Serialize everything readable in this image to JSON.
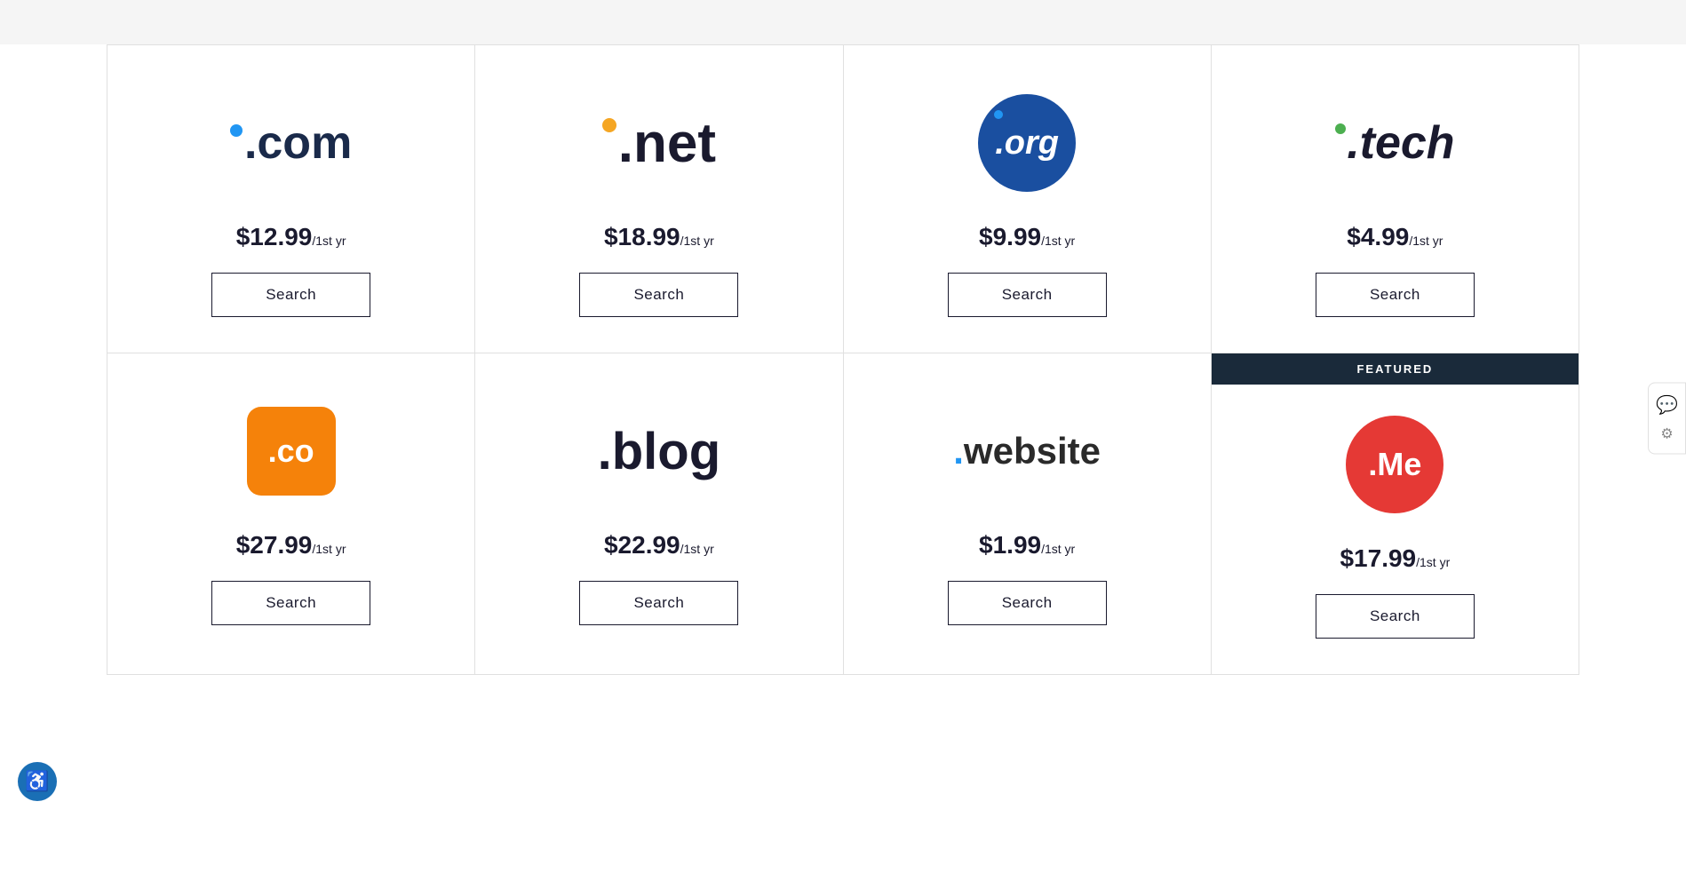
{
  "domains": {
    "row1": [
      {
        "id": "com",
        "type": "com",
        "price_main": "$12.99",
        "price_period": "/1st yr",
        "search_label": "Search",
        "featured": false
      },
      {
        "id": "net",
        "type": "net",
        "price_main": "$18.99",
        "price_period": "/1st yr",
        "search_label": "Search",
        "featured": false
      },
      {
        "id": "org",
        "type": "org",
        "price_main": "$9.99",
        "price_period": "/1st yr",
        "search_label": "Search",
        "featured": false
      },
      {
        "id": "tech",
        "type": "tech",
        "price_main": "$4.99",
        "price_period": "/1st yr",
        "search_label": "Search",
        "featured": false
      }
    ],
    "row2": [
      {
        "id": "co",
        "type": "co",
        "price_main": "$27.99",
        "price_period": "/1st yr",
        "search_label": "Search",
        "featured": false
      },
      {
        "id": "blog",
        "type": "blog",
        "price_main": "$22.99",
        "price_period": "/1st yr",
        "search_label": "Search",
        "featured": false
      },
      {
        "id": "website",
        "type": "website",
        "price_main": "$1.99",
        "price_period": "/1st yr",
        "search_label": "Search",
        "featured": false
      },
      {
        "id": "me",
        "type": "me",
        "price_main": "$17.99",
        "price_period": "/1st yr",
        "search_label": "Search",
        "featured": true,
        "featured_label": "FEATURED"
      }
    ]
  },
  "accessibility": {
    "icon": "♿"
  },
  "side_widget": {
    "chat_icon": "💬",
    "dots_icon": "⚙"
  }
}
